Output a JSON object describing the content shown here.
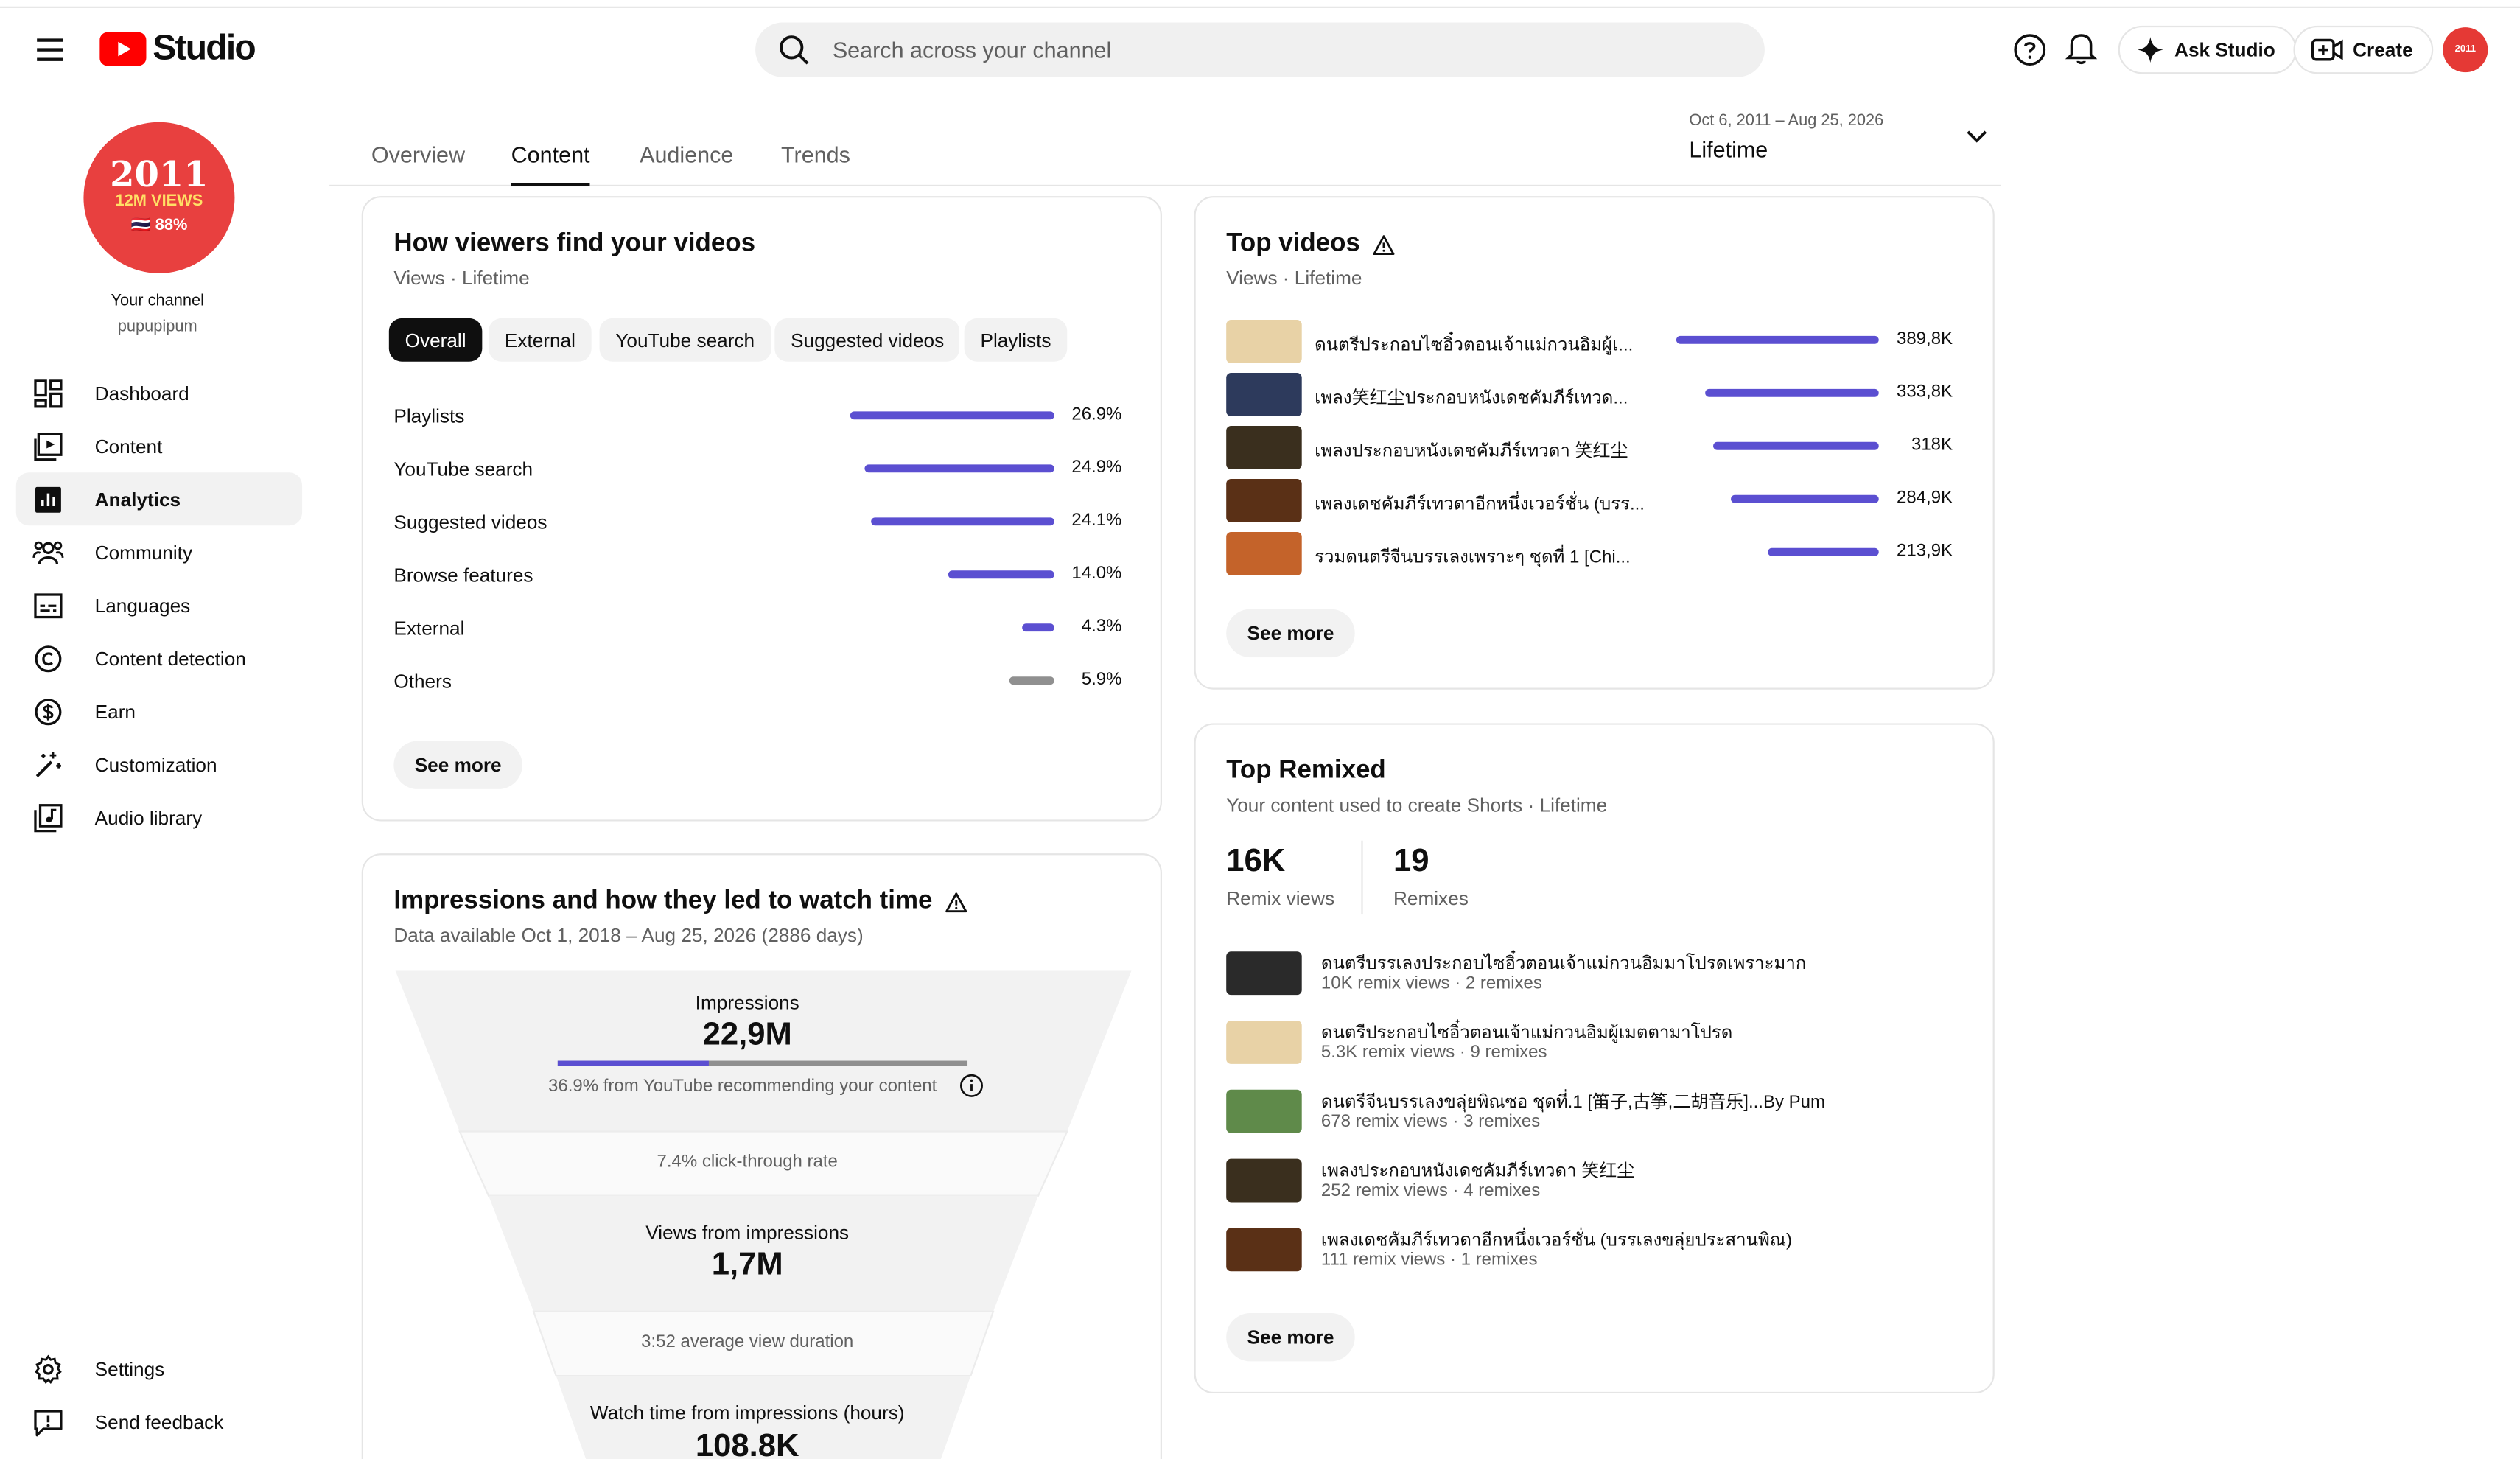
{
  "header": {
    "logo_text": "Studio",
    "search_placeholder": "Search across your channel",
    "ask_studio": "Ask Studio",
    "create": "Create",
    "avatar_small": "2011"
  },
  "channel": {
    "avatar_year": "2011",
    "avatar_views": "12M VIEWS",
    "avatar_pct": "🇹🇭 88%",
    "label": "Your channel",
    "handle": "pupupipum"
  },
  "sidebar": {
    "items": [
      {
        "label": "Dashboard",
        "icon": "dashboard-icon"
      },
      {
        "label": "Content",
        "icon": "content-icon"
      },
      {
        "label": "Analytics",
        "icon": "analytics-icon"
      },
      {
        "label": "Community",
        "icon": "community-icon"
      },
      {
        "label": "Languages",
        "icon": "subtitles-icon"
      },
      {
        "label": "Content detection",
        "icon": "copyright-icon"
      },
      {
        "label": "Earn",
        "icon": "dollar-icon"
      },
      {
        "label": "Customization",
        "icon": "magic-wand-icon"
      },
      {
        "label": "Audio library",
        "icon": "audio-library-icon"
      }
    ],
    "settings": "Settings",
    "feedback": "Send feedback"
  },
  "tabs": [
    "Overview",
    "Content",
    "Audience",
    "Trends"
  ],
  "date_range": {
    "dates": "Oct 6, 2011 – Aug 25, 2026",
    "label": "Lifetime"
  },
  "find_card": {
    "title": "How viewers find your videos",
    "subtitle": "Views · Lifetime",
    "chips": [
      "Overall",
      "External",
      "YouTube search",
      "Suggested videos",
      "Playlists"
    ],
    "sources": [
      {
        "label": "Playlists",
        "pct": "26.9%",
        "fraction": 0.269
      },
      {
        "label": "YouTube search",
        "pct": "24.9%",
        "fraction": 0.249
      },
      {
        "label": "Suggested videos",
        "pct": "24.1%",
        "fraction": 0.241
      },
      {
        "label": "Browse features",
        "pct": "14.0%",
        "fraction": 0.14
      },
      {
        "label": "External",
        "pct": "4.3%",
        "fraction": 0.043
      },
      {
        "label": "Others",
        "pct": "5.9%",
        "fraction": 0.059
      }
    ],
    "see_more": "See more"
  },
  "impressions_card": {
    "title": "Impressions and how they led to watch time",
    "subtitle": "Data available Oct 1, 2018 – Aug 25, 2026 (2886 days)",
    "impressions_label": "Impressions",
    "impressions_value": "22,9M",
    "recommend_fraction": 0.369,
    "recommend_text": "36.9% from YouTube recommending your content",
    "ctr_text": "7.4% click-through rate",
    "views_label": "Views from impressions",
    "views_value": "1,7M",
    "avd_text": "3:52 average view duration",
    "watch_label": "Watch time from impressions (hours)",
    "watch_value": "108.8K"
  },
  "top_videos": {
    "title": "Top videos",
    "subtitle": "Views · Lifetime",
    "items": [
      {
        "title": "ดนตรีประกอบไซอิ๋วตอนเจ้าแม่กวนอิมผู้เ...",
        "views": "389,8K",
        "fraction": 1.0,
        "thumb": "#e8d2a6"
      },
      {
        "title": "เพลง笑红尘ประกอบหนังเดชคัมภีร์เทวด...",
        "views": "333,8K",
        "fraction": 0.856,
        "thumb": "#2d3a5c"
      },
      {
        "title": "เพลงประกอบหนังเดชคัมภีร์เทวดา 笑红尘",
        "views": "318K",
        "fraction": 0.816,
        "thumb": "#3a2f1e"
      },
      {
        "title": "เพลงเดชคัมภีร์เทวดาอีกหนึ่งเวอร์ชั่น (บรร...",
        "views": "284,9K",
        "fraction": 0.731,
        "thumb": "#5a3016"
      },
      {
        "title": "รวมดนตรีจีนบรรเลงเพราะๆ ชุดที่ 1 [Chi...",
        "views": "213,9K",
        "fraction": 0.549,
        "thumb": "#c4632a"
      }
    ],
    "see_more": "See more"
  },
  "top_remixed": {
    "title": "Top Remixed",
    "subtitle": "Your content used to create Shorts · Lifetime",
    "remix_views_value": "16K",
    "remix_views_label": "Remix views",
    "remixes_value": "19",
    "remixes_label": "Remixes",
    "items": [
      {
        "title": "ดนตรีบรรเลงประกอบไซอิ๋วตอนเจ้าแม่กวนอิมมาโปรดเพราะมาก",
        "sub": "10K remix views · 2 remixes",
        "thumb": "#2a2a2a"
      },
      {
        "title": "ดนตรีประกอบไซอิ๋วตอนเจ้าแม่กวนอิมผู้เมตตามาโปรด",
        "sub": "5.3K remix views · 9 remixes",
        "thumb": "#e8d2a6"
      },
      {
        "title": "ดนตรีจีนบรรเลงขลุ่ยพิณซอ ชุดที่.1 [笛子,古筝,二胡音乐]...By Pum",
        "sub": "678 remix views · 3 remixes",
        "thumb": "#5f8a4a"
      },
      {
        "title": "เพลงประกอบหนังเดชคัมภีร์เทวดา 笑红尘",
        "sub": "252 remix views · 4 remixes",
        "thumb": "#3a2f1e"
      },
      {
        "title": "เพลงเดชคัมภีร์เทวดาอีกหนึ่งเวอร์ชั่น (บรรเลงขลุ่ยประสานพิณ)",
        "sub": "111 remix views · 1 remixes",
        "thumb": "#5a3016"
      }
    ],
    "see_more": "See more"
  },
  "colors": {
    "accent": "#5b4fd1",
    "brand_red": "#ff0000",
    "avatar_red": "#e8403f"
  }
}
